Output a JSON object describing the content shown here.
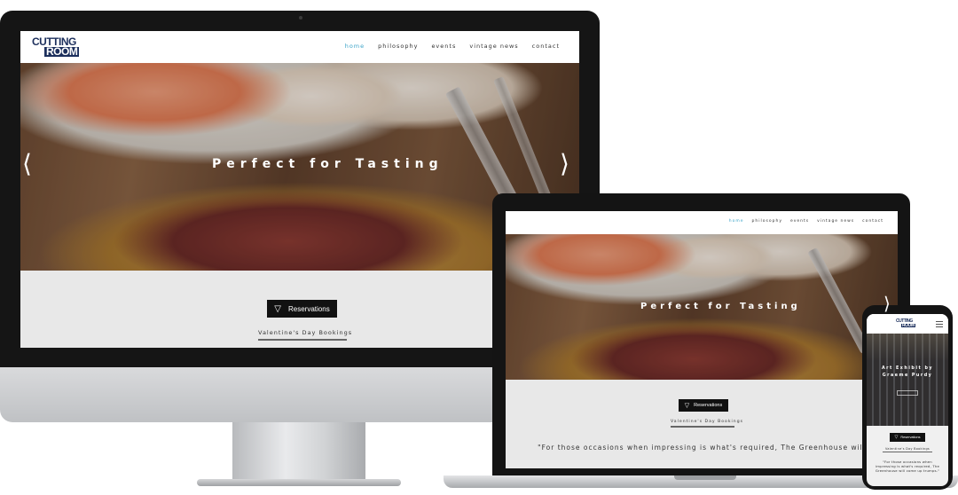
{
  "site": {
    "logo_line1": "CUTTING",
    "logo_line2": "ROOM",
    "nav": [
      "home",
      "philosophy",
      "events",
      "vintage news",
      "contact"
    ],
    "active_nav": "home",
    "hero_slogan": "Perfect for Tasting",
    "reservations_icon": "▽",
    "reservations_label": "Reservations",
    "valentines_link": "Valentine's Day Bookings",
    "quote_laptop": "\"For those occasions when impressing is what's required, The Greenhouse will",
    "accent_color": "#3aa3c8",
    "brand_color": "#1c2f5c"
  },
  "phone": {
    "hero_slogan": "Art Exhibit by Graeme Purdy",
    "quote": "\"For those occasions when impressing is what's required, The Greenhouse will come up trumps.\""
  },
  "icons": {
    "prev": "chevron-left-icon",
    "next": "chevron-right-icon",
    "menu": "hamburger-menu-icon"
  }
}
